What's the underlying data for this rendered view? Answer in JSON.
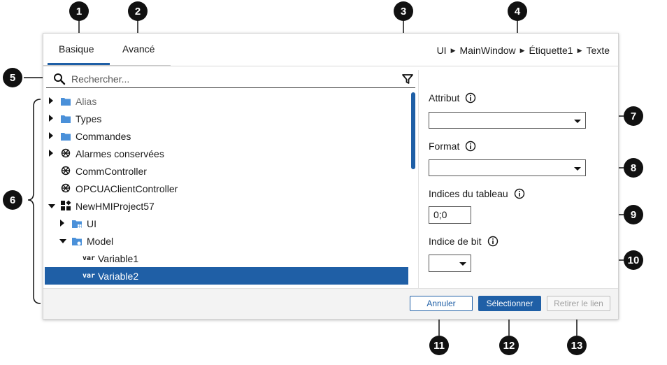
{
  "tabs": [
    {
      "label": "Basique",
      "active": true
    },
    {
      "label": "Avancé",
      "active": false
    }
  ],
  "breadcrumb": [
    "UI",
    "MainWindow",
    "Étiquette1",
    "Texte"
  ],
  "search": {
    "placeholder": "Rechercher...",
    "value": ""
  },
  "tree": [
    {
      "label": "Alias",
      "icon": "folder-icon",
      "expander": "collapsed",
      "muted": true
    },
    {
      "label": "Types",
      "icon": "folder-icon",
      "expander": "collapsed"
    },
    {
      "label": "Commandes",
      "icon": "folder-icon",
      "expander": "collapsed"
    },
    {
      "label": "Alarmes conservées",
      "icon": "network-icon",
      "expander": "collapsed"
    },
    {
      "label": "CommController",
      "icon": "network-icon",
      "expander": "none"
    },
    {
      "label": "OPCUAClientController",
      "icon": "network-icon",
      "expander": "none"
    },
    {
      "label": "NewHMIProject57",
      "icon": "project-icon",
      "expander": "expanded"
    },
    {
      "label": "UI",
      "icon": "ui-folder-icon",
      "expander": "collapsed"
    },
    {
      "label": "Model",
      "icon": "model-folder-icon",
      "expander": "expanded"
    },
    {
      "label": "Variable1",
      "tag": "var"
    },
    {
      "label": "Variable2",
      "tag": "var",
      "selected": true
    }
  ],
  "fields": {
    "attribut": {
      "label": "Attribut",
      "value": ""
    },
    "format": {
      "label": "Format",
      "value": ""
    },
    "indices": {
      "label": "Indices du tableau",
      "value": "0;0"
    },
    "bit": {
      "label": "Indice de bit",
      "value": ""
    }
  },
  "buttons": {
    "cancel": "Annuler",
    "select": "Sélectionner",
    "remove": "Retirer le lien"
  },
  "callouts": [
    "1",
    "2",
    "3",
    "4",
    "5",
    "6",
    "7",
    "8",
    "9",
    "10",
    "11",
    "12",
    "13"
  ],
  "colors": {
    "accent": "#1f5fa6",
    "folder": "#4a90d9",
    "disabled": "#a0a0a0"
  }
}
